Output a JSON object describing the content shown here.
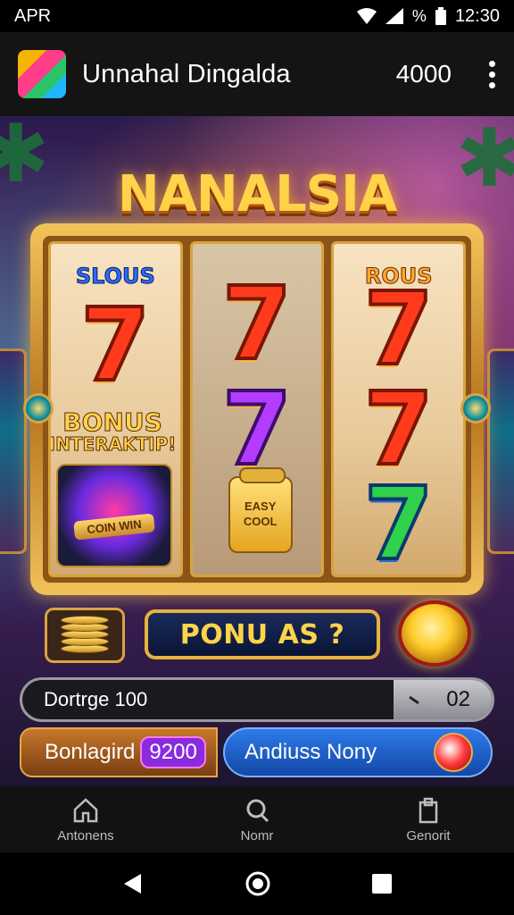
{
  "status_bar": {
    "carrier": "APR",
    "battery": "%",
    "time": "12:30"
  },
  "app_bar": {
    "title": "Unnahal Dingalda",
    "count": "4000",
    "logo_icon": "app-logo-icon",
    "menu_icon": "more-vert-icon"
  },
  "game": {
    "title": "NANALSIA",
    "reel1_label": "SLOUS",
    "reel3_label": "ROUS",
    "bonus_line1": "BONUS",
    "bonus_line2": "INTERAKTIP!",
    "orb_label": "COIN WIN",
    "jar_label": "EASY COOL",
    "bonus_button_label": "PONU AS ?",
    "progress": {
      "label": "Dortrge 100",
      "value": "02"
    },
    "bonus_pill": {
      "label": "Bonlagird",
      "badge": "9200"
    },
    "action_pill": {
      "label": "Andiuss Nony"
    }
  },
  "bottom_nav": [
    {
      "label": "Antonens",
      "icon": "home-icon"
    },
    {
      "label": "Nomr",
      "icon": "search-icon"
    },
    {
      "label": "Genorit",
      "icon": "clipboard-icon"
    }
  ],
  "colors": {
    "accent_gold": "#ffd34a",
    "seven_red": "#ff3b1c",
    "seven_purple": "#b23cff",
    "seven_green": "#2fd24a"
  }
}
